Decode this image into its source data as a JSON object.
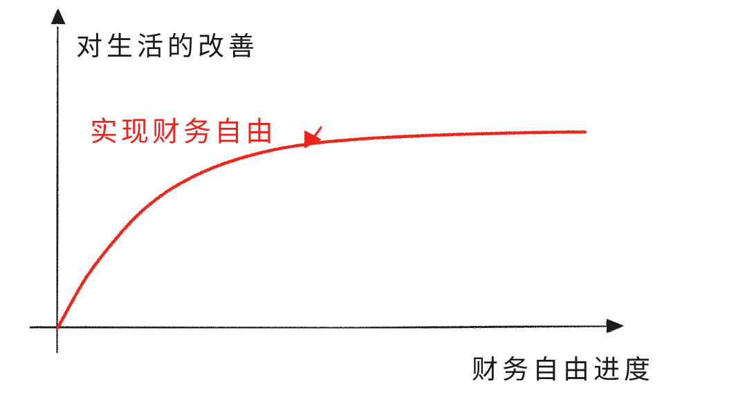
{
  "chart_data": {
    "type": "line",
    "title": "",
    "xlabel": "财务自由进度",
    "ylabel": "对生活的改善",
    "grid": false,
    "legend": "none",
    "tick_labels": false,
    "series": [
      {
        "color": "#e8251e",
        "x": [
          0,
          0.05,
          0.1,
          0.15,
          0.2,
          0.25,
          0.3,
          0.35,
          0.4,
          0.45,
          0.5,
          0.55,
          0.6,
          0.65,
          0.7,
          0.75,
          0.8,
          0.85,
          0.9,
          0.95,
          1.0
        ],
        "y": [
          0,
          0.24,
          0.42,
          0.57,
          0.68,
          0.76,
          0.82,
          0.865,
          0.9,
          0.925,
          0.943,
          0.955,
          0.965,
          0.972,
          0.978,
          0.983,
          0.987,
          0.99,
          0.993,
          0.995,
          0.996
        ]
      }
    ],
    "annotation": {
      "text": "实现财务自由",
      "color": "#e8251e",
      "points_to": {
        "x": 0.5,
        "y": 0.943
      }
    },
    "axis_color": "#1a1a1a"
  }
}
